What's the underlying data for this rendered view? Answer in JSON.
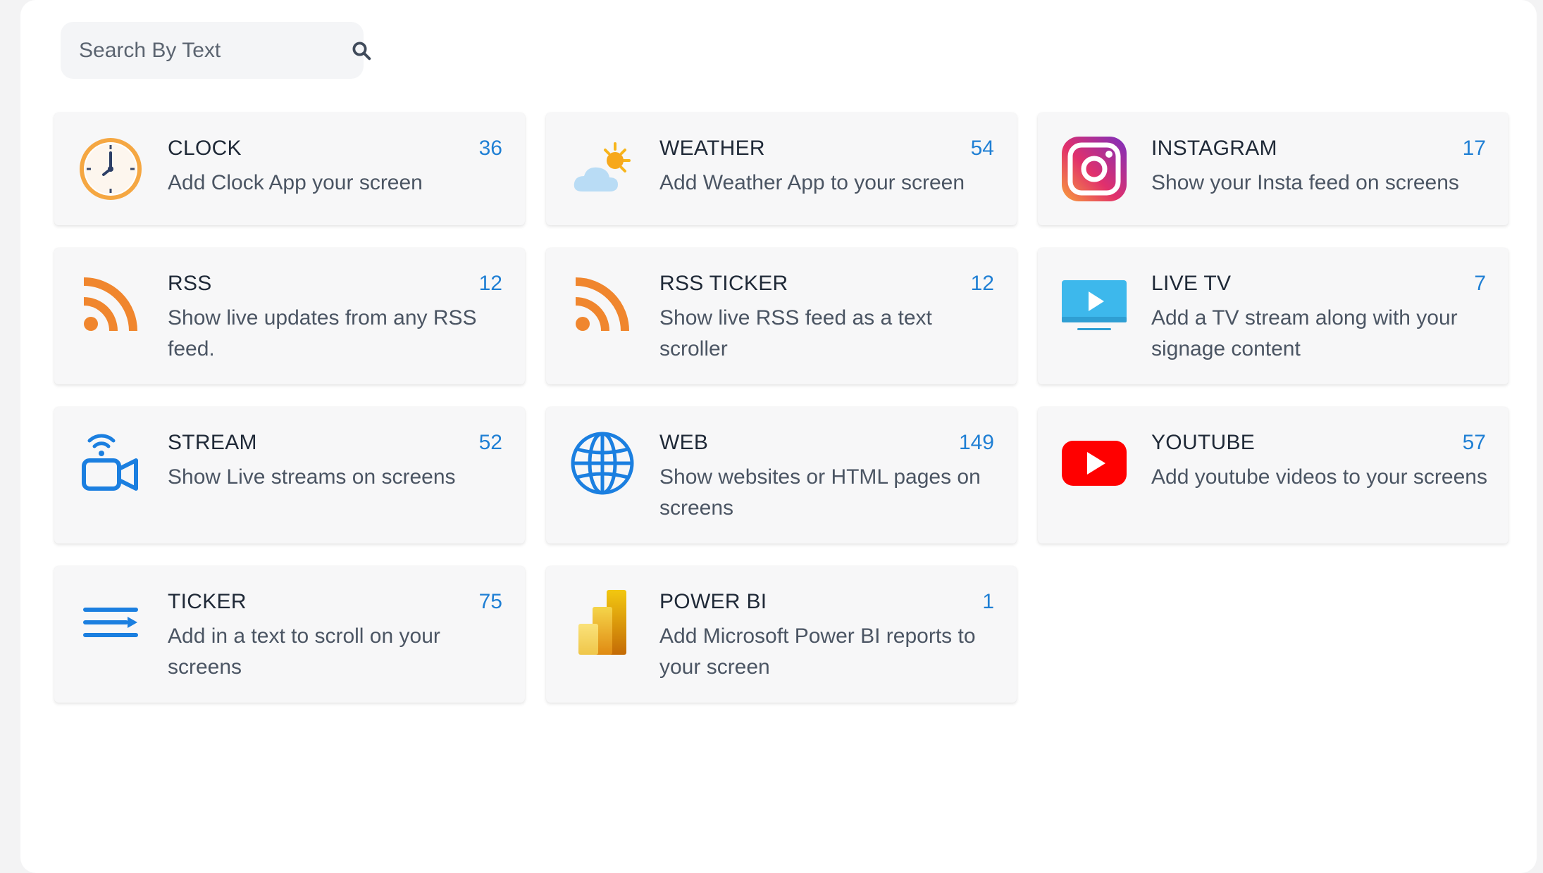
{
  "search": {
    "placeholder": "Search By Text",
    "value": ""
  },
  "apps": [
    {
      "title": "CLOCK",
      "count": "36",
      "desc": "Add Clock App your screen",
      "icon": "clock-icon"
    },
    {
      "title": "WEATHER",
      "count": "54",
      "desc": "Add Weather App to your screen",
      "icon": "weather-icon"
    },
    {
      "title": "INSTAGRAM",
      "count": "17",
      "desc": "Show your Insta feed on screens",
      "icon": "instagram-icon"
    },
    {
      "title": "RSS",
      "count": "12",
      "desc": "Show live updates from any RSS feed.",
      "icon": "rss-icon"
    },
    {
      "title": "RSS TICKER",
      "count": "12",
      "desc": "Show live RSS feed as a text scroller",
      "icon": "rss-ticker-icon"
    },
    {
      "title": "LIVE TV",
      "count": "7",
      "desc": "Add a TV stream along with your signage content",
      "icon": "tv-icon"
    },
    {
      "title": "STREAM",
      "count": "52",
      "desc": "Show Live streams on screens",
      "icon": "stream-camera-icon"
    },
    {
      "title": "WEB",
      "count": "149",
      "desc": "Show websites or HTML pages on screens",
      "icon": "globe-icon"
    },
    {
      "title": "YOUTUBE",
      "count": "57",
      "desc": "Add youtube videos to your screens",
      "icon": "youtube-icon"
    },
    {
      "title": "TICKER",
      "count": "75",
      "desc": "Add in a text to scroll on your screens",
      "icon": "ticker-icon"
    },
    {
      "title": "POWER BI",
      "count": "1",
      "desc": "Add Microsoft Power BI reports to your screen",
      "icon": "powerbi-icon"
    }
  ],
  "colors": {
    "accent": "#1f7fd4",
    "rss": "#f0862e",
    "youtube": "#ff0000"
  }
}
